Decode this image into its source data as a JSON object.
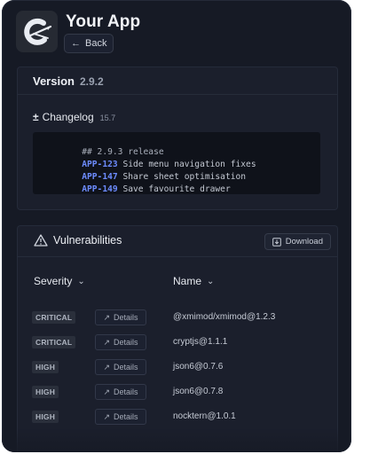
{
  "header": {
    "app_title": "Your App",
    "back_label": "Back",
    "app_icon": "app-logo"
  },
  "version": {
    "label": "Version",
    "number": "2.9.2"
  },
  "changelog": {
    "icon": "plus-minus-icon",
    "label": "Changelog",
    "count": "15.7",
    "lines": [
      {
        "key": "",
        "text": "## 2.9.3 release"
      },
      {
        "key": "APP-123",
        "text": "Side menu navigation fixes"
      },
      {
        "key": "APP-147",
        "text": "Share sheet optimisation"
      },
      {
        "key": "APP-149",
        "text": "Save favourite drawer"
      }
    ]
  },
  "vulnerabilities": {
    "title": "Vulnerabilities",
    "download_label": "Download",
    "columns": {
      "severity": "Severity",
      "name": "Name"
    },
    "details_label": "Details",
    "rows": [
      {
        "severity": "CRITICAL",
        "name": "@xmimod/xmimod@1.2.3"
      },
      {
        "severity": "CRITICAL",
        "name": "cryptjs@1.1.1"
      },
      {
        "severity": "HIGH",
        "name": "json6@0.7.6"
      },
      {
        "severity": "HIGH",
        "name": "json6@0.7.8"
      },
      {
        "severity": "HIGH",
        "name": "nocktern@1.0.1"
      }
    ]
  },
  "colors": {
    "background": "#161a25",
    "card": "#1b1f2c",
    "code_key": "#6d8cff"
  }
}
